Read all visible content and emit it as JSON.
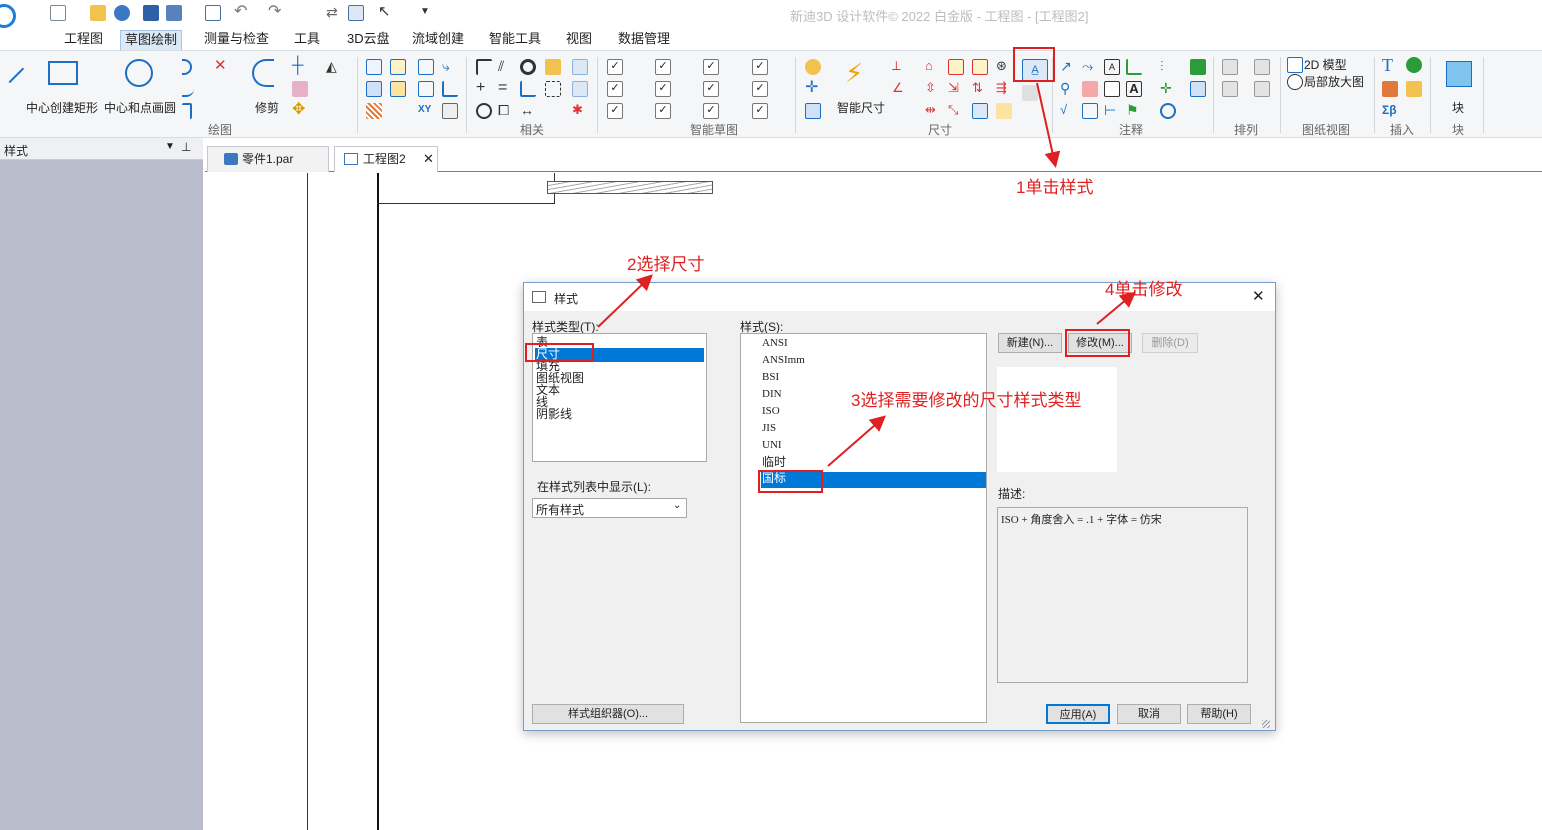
{
  "app": {
    "title": "新迪3D 设计软件© 2022 白金版 - 工程图 - [工程图2]"
  },
  "ribbon_tabs": [
    "工程图",
    "草图绘制",
    "测量与检查",
    "工具",
    "3D云盘",
    "流域创建",
    "智能工具",
    "视图",
    "数据管理"
  ],
  "ribbon": {
    "draw": {
      "center_rect": "中心创建矩形",
      "center_circle": "中心和点画圆",
      "trim": "修剪",
      "group": "绘图"
    },
    "relate_group": "相关",
    "smart_sketch_group": "智能草图",
    "dimension": {
      "smart_dim": "智能尺寸",
      "group": "尺寸"
    },
    "annotation_group": "注释",
    "arrange_group": "排列",
    "view": {
      "model_2d": "2D 模型",
      "detail_view": "局部放大图",
      "group": "图纸视图"
    },
    "insert_group": "插入",
    "block": {
      "label": "块",
      "group": "块"
    }
  },
  "left_pane": {
    "title": "样式"
  },
  "doc_tabs": [
    "零件1.par",
    "工程图2"
  ],
  "dialog": {
    "title": "样式",
    "style_type_label": "样式类型(T):",
    "style_types": [
      "表",
      "尺寸",
      "填充",
      "图纸视图",
      "文本",
      "线",
      "阴影线"
    ],
    "selected_type": "尺寸",
    "styles_label": "样式(S):",
    "styles": [
      "ANSI",
      "ANSImm",
      "BSI",
      "DIN",
      "ISO",
      "JIS",
      "UNI",
      "临时",
      "国标"
    ],
    "selected_style": "国标",
    "new_btn": "新建(N)...",
    "modify_btn": "修改(M)...",
    "delete_btn": "删除(D)",
    "desc_label": "描述:",
    "description": "ISO + 角度舍入 = .1 + 字体 = 仿宋",
    "show_label": "在样式列表中显示(L):",
    "show_value": "所有样式",
    "organizer_btn": "样式组织器(O)...",
    "apply_btn": "应用(A)",
    "cancel_btn": "取消",
    "help_btn": "帮助(H)"
  },
  "annotations": [
    "1单击样式",
    "2选择尺寸",
    "3选择需要修改的尺寸样式类型",
    "4单击修改"
  ],
  "colors": {
    "annotation": "#e02020",
    "selection": "#0078d7"
  }
}
